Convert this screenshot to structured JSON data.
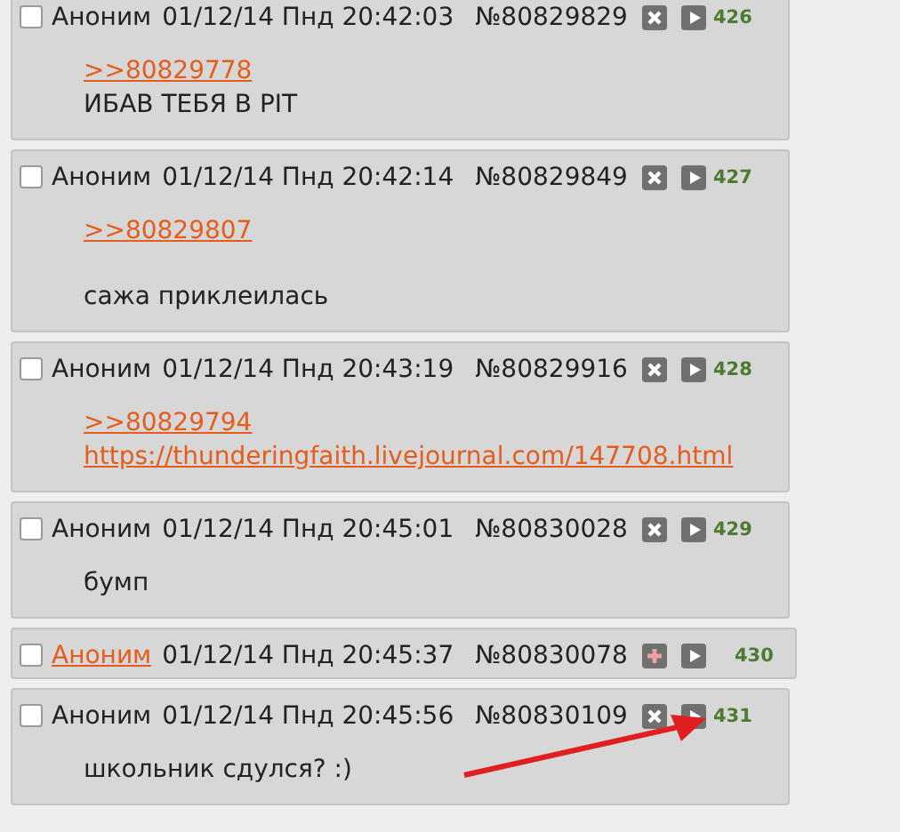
{
  "posts": [
    {
      "name": "Аноним",
      "name_is_link": false,
      "date": "01/12/14 Пнд 20:42:03",
      "number": "№80829829",
      "hidden": false,
      "counter": "426",
      "checked": false,
      "arrow": false,
      "lines": [
        {
          "kind": "reply",
          "text": ">>80829778"
        },
        {
          "kind": "line",
          "text": "ИБАВ ТЕБЯ В PIT"
        }
      ]
    },
    {
      "name": "Аноним",
      "name_is_link": false,
      "date": "01/12/14 Пнд 20:42:14",
      "number": "№80829849",
      "hidden": false,
      "counter": "427",
      "checked": false,
      "arrow": false,
      "lines": [
        {
          "kind": "reply",
          "text": ">>80829807"
        },
        {
          "kind": "paragraph",
          "text": "сажа приклеилась"
        }
      ]
    },
    {
      "name": "Аноним",
      "name_is_link": false,
      "date": "01/12/14 Пнд 20:43:19",
      "number": "№80829916",
      "hidden": false,
      "counter": "428",
      "checked": false,
      "arrow": false,
      "lines": [
        {
          "kind": "reply",
          "text": ">>80829794"
        },
        {
          "kind": "url",
          "text": "https://thunderingfaith.livejournal.com/147708.html"
        }
      ]
    },
    {
      "name": "Аноним",
      "name_is_link": false,
      "date": "01/12/14 Пнд 20:45:01",
      "number": "№80830028",
      "hidden": false,
      "counter": "429",
      "checked": false,
      "arrow": false,
      "lines": [
        {
          "kind": "line",
          "text": "бумп"
        }
      ]
    },
    {
      "name": "Аноним",
      "name_is_link": true,
      "date": "01/12/14 Пнд 20:45:37",
      "number": "№80830078",
      "hidden": true,
      "counter": "430",
      "checked": false,
      "arrow": false
    },
    {
      "name": "Аноним",
      "name_is_link": false,
      "date": "01/12/14 Пнд 20:45:56",
      "number": "№80830109",
      "hidden": false,
      "counter": "431",
      "checked": false,
      "arrow": true,
      "lines": [
        {
          "kind": "line",
          "text": "школьник сдулся? :)"
        }
      ]
    }
  ]
}
